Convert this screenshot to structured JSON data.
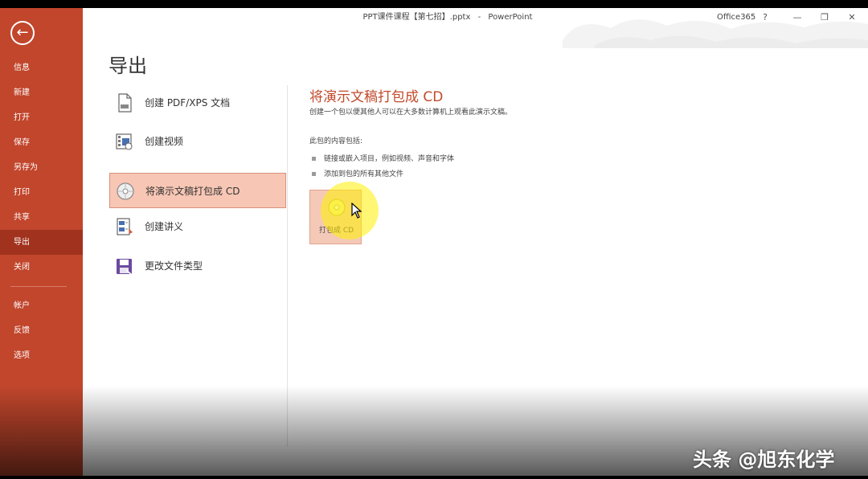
{
  "window": {
    "title": "PPT课件课程【第七招】.pptx",
    "app": "PowerPoint",
    "office_label": "Office365",
    "help": "?",
    "minimize": "—",
    "restore": "❐",
    "close": "✕"
  },
  "sidebar": {
    "back_icon": "←",
    "items": [
      {
        "label": "信息"
      },
      {
        "label": "新建"
      },
      {
        "label": "打开"
      },
      {
        "label": "保存"
      },
      {
        "label": "另存为"
      },
      {
        "label": "打印"
      },
      {
        "label": "共享"
      },
      {
        "label": "导出"
      },
      {
        "label": "关闭"
      },
      {
        "label": "帐户"
      },
      {
        "label": "反馈"
      },
      {
        "label": "选项"
      }
    ],
    "active": "导出"
  },
  "page": {
    "title": "导出"
  },
  "export_options": [
    {
      "label": "创建 PDF/XPS 文档",
      "icon": "pdf-document-icon"
    },
    {
      "label": "创建视频",
      "icon": "video-icon"
    },
    {
      "label": "将演示文稿打包成 CD",
      "icon": "cd-icon"
    },
    {
      "label": "创建讲义",
      "icon": "handout-icon"
    },
    {
      "label": "更改文件类型",
      "icon": "save-disk-icon"
    }
  ],
  "detail": {
    "heading": "将演示文稿打包成 CD",
    "description": "创建一个包以便其他人可以在大多数计算机上观看此演示文稿。",
    "contents_title": "此包的内容包括:",
    "bullets": [
      "链接或嵌入项目，例如视频、声音和字体",
      "添加到包的所有其他文件"
    ],
    "button_label": "打包成 CD"
  },
  "watermark": "头条 @旭东化学",
  "colors": {
    "accent": "#c1462c",
    "active_nav": "#a1321d",
    "selected_bg": "#f7c6b4"
  }
}
